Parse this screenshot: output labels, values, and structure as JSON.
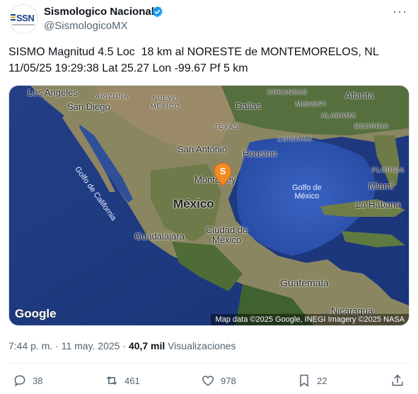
{
  "post": {
    "author_name": "Sismologico Nacional",
    "author_handle": "@SismologicoMX",
    "avatar_text": "SSN",
    "more_label": "···",
    "text": "SISMO Magnitud 4.5 Loc  18 km al NORESTE de MONTEMORELOS, NL\n11/05/25 19:29:38 Lat 25.27 Lon -99.67 Pf 5 km",
    "time": "7:44 p. m. · 11 may. 2025 · ",
    "views_count": "40,7 mil",
    "views_label": " Visualizaciones"
  },
  "map": {
    "pin_label": "S",
    "google_logo": "Google",
    "attribution": "Map data ©2025 Google, INEGI Imagery ©2025 NASA",
    "labels": {
      "los_angeles": "Los Angeles",
      "san_diego": "San Diego",
      "arizona": "ARIZONA",
      "nuevo_mexico": "NUEVO\nMÉXICO",
      "dallas": "Dallas",
      "texas": "TEXAS",
      "arkansas": "ARKANSAS",
      "misisipi": "MISISIPI",
      "alabama": "ALABAMA",
      "atlanta": "Atlanta",
      "georgia": "GEORGIA",
      "luisiana": "LUISIANA",
      "san_antonio": "San Antonio",
      "houston": "Houston",
      "florida": "FLORIDA",
      "golfo_california": "Golfo de California",
      "monterrey": "Monterrey",
      "golfo_mexico": "Golfo de\nMéxico",
      "miami": "Miami",
      "mexico": "México",
      "la_habana": "La Habana",
      "guadalajara": "Guadalajara",
      "ciudad_mexico": "Ciudad de\nMéxico",
      "guatemala": "Guatemala",
      "nicaragua": "Nicaragua"
    }
  },
  "actions": {
    "replies": "38",
    "reposts": "461",
    "likes": "978",
    "bookmarks": "22"
  },
  "colors": {
    "pin": "#f28b22",
    "verified": "#1d9bf0",
    "ocean": "#1f3f8a",
    "land": "#7a7a5a"
  }
}
